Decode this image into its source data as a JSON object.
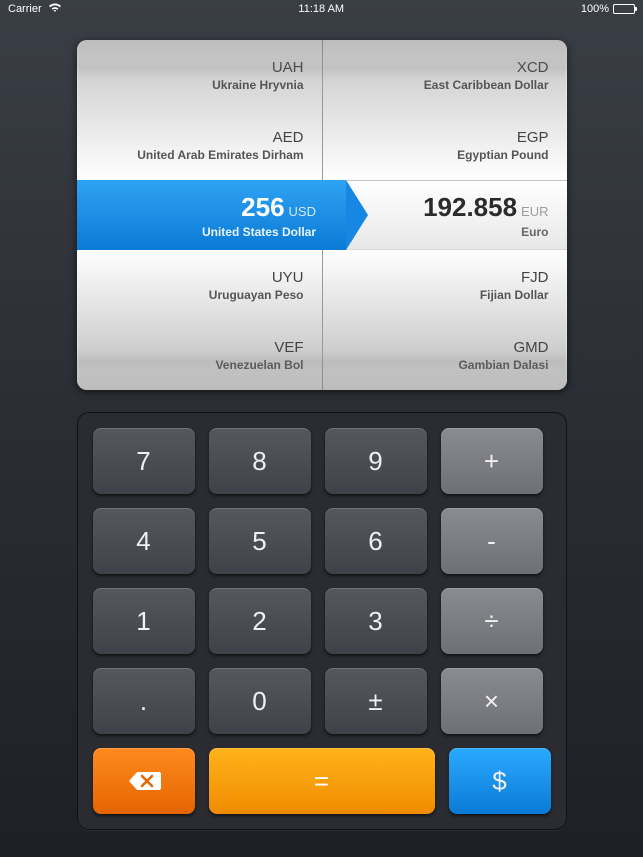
{
  "status_bar": {
    "carrier": "Carrier",
    "time": "11:18 AM",
    "battery": "100%"
  },
  "picker": {
    "left": {
      "items": [
        {
          "code": "UAH",
          "name": "Ukraine Hryvnia"
        },
        {
          "code": "AED",
          "name": "United Arab Emirates Dirham"
        },
        {
          "code": "USD",
          "name": "United States Dollar"
        },
        {
          "code": "UYU",
          "name": "Uruguayan Peso"
        },
        {
          "code": "VEF",
          "name": "Venezuelan Bol"
        }
      ],
      "selected_value": "256",
      "selected_code": "USD",
      "selected_name": "United States Dollar"
    },
    "right": {
      "items": [
        {
          "code": "XCD",
          "name": "East Caribbean Dollar"
        },
        {
          "code": "EGP",
          "name": "Egyptian Pound"
        },
        {
          "code": "EUR",
          "name": "Euro"
        },
        {
          "code": "FJD",
          "name": "Fijian Dollar"
        },
        {
          "code": "GMD",
          "name": "Gambian Dalasi"
        }
      ],
      "selected_value": "192.858",
      "selected_code": "EUR",
      "selected_name": "Euro"
    }
  },
  "keypad": {
    "k7": "7",
    "k8": "8",
    "k9": "9",
    "plus": "+",
    "k4": "4",
    "k5": "5",
    "k6": "6",
    "minus": "-",
    "k1": "1",
    "k2": "2",
    "k3": "3",
    "divide": "÷",
    "dot": ".",
    "k0": "0",
    "plusminus": "±",
    "times": "×",
    "equals": "=",
    "dollar": "$"
  }
}
